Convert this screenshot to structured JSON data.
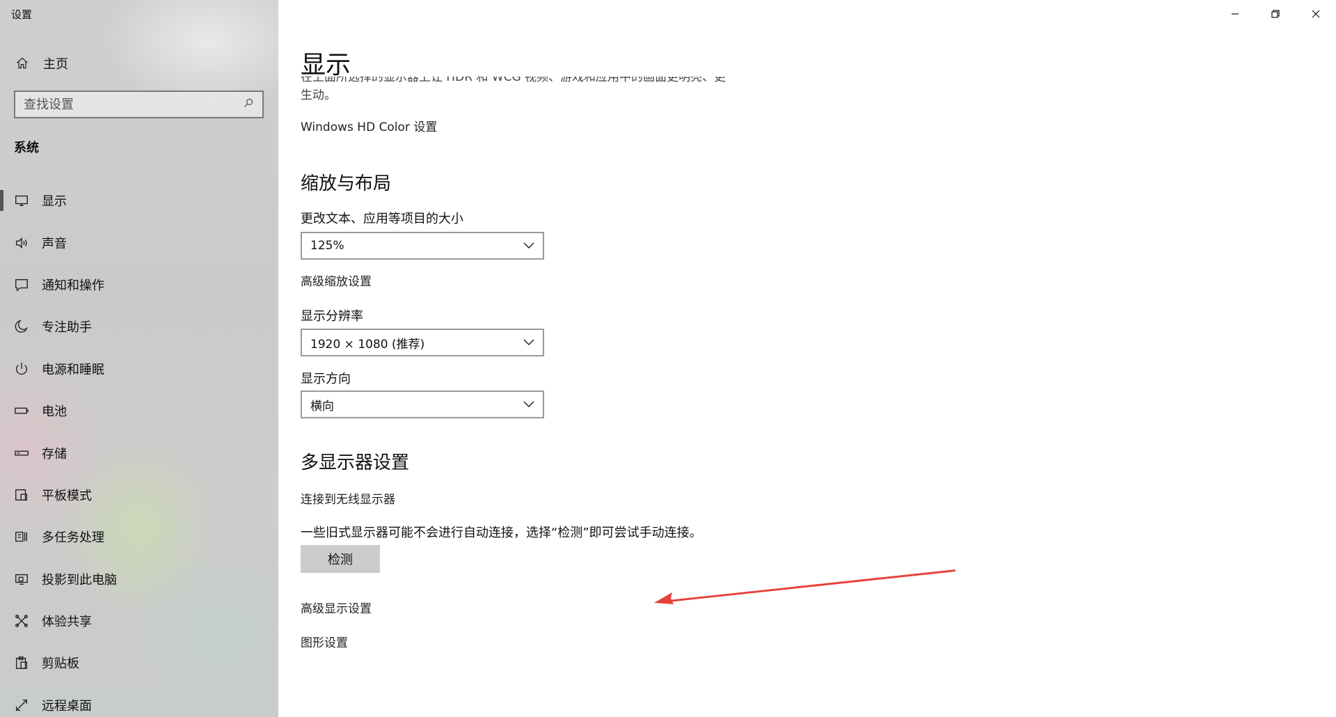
{
  "app": {
    "title": "设置"
  },
  "sidebar": {
    "home_label": "主页",
    "search": {
      "placeholder": "查找设置"
    },
    "section_label": "系统",
    "items": [
      {
        "label": "显示",
        "icon": "monitor-icon",
        "selected": true
      },
      {
        "label": "声音",
        "icon": "speaker-icon",
        "selected": false
      },
      {
        "label": "通知和操作",
        "icon": "notification-icon",
        "selected": false
      },
      {
        "label": "专注助手",
        "icon": "moon-icon",
        "selected": false
      },
      {
        "label": "电源和睡眠",
        "icon": "power-icon",
        "selected": false
      },
      {
        "label": "电池",
        "icon": "battery-icon",
        "selected": false
      },
      {
        "label": "存储",
        "icon": "storage-icon",
        "selected": false
      },
      {
        "label": "平板模式",
        "icon": "tablet-icon",
        "selected": false
      },
      {
        "label": "多任务处理",
        "icon": "multitask-icon",
        "selected": false
      },
      {
        "label": "投影到此电脑",
        "icon": "project-icon",
        "selected": false
      },
      {
        "label": "体验共享",
        "icon": "share-icon",
        "selected": false
      },
      {
        "label": "剪贴板",
        "icon": "clipboard-icon",
        "selected": false
      },
      {
        "label": "远程桌面",
        "icon": "remote-icon",
        "selected": false
      }
    ]
  },
  "main": {
    "title": "显示",
    "hdr_text": "在上面所选择的显示器上让 HDR 和 WCG 视频、游戏和应用中的画面更明亮、更生动。",
    "hdr_link": "Windows HD Color 设置",
    "scale_section": {
      "heading": "缩放与布局",
      "text_size_label": "更改文本、应用等项目的大小",
      "text_size_value": "125%",
      "advanced_scaling_link": "高级缩放设置",
      "resolution_label": "显示分辨率",
      "resolution_value": "1920 × 1080 (推荐)",
      "orientation_label": "显示方向",
      "orientation_value": "横向"
    },
    "multi_section": {
      "heading": "多显示器设置",
      "wireless_link": "连接到无线显示器",
      "detect_desc": "一些旧式显示器可能不会进行自动连接，选择“检测”即可尝试手动连接。",
      "detect_button": "检测",
      "advanced_display_link": "高级显示设置",
      "graphics_link": "图形设置"
    },
    "annotation_color": "#e8403a"
  }
}
